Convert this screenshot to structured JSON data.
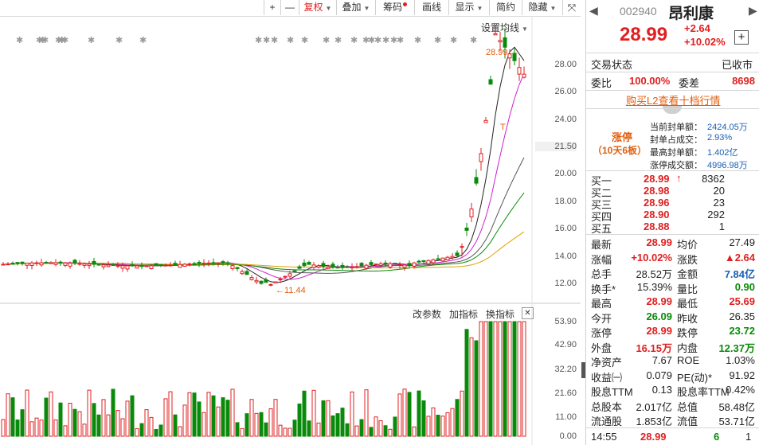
{
  "toolbar": {
    "plus": "+",
    "minus": "—",
    "fuquan": "复权",
    "diejia": "叠加",
    "chouma": "筹码",
    "huaxian": "画线",
    "xianshi": "显示",
    "jianyue": "简约",
    "yincang": "隐藏"
  },
  "chart": {
    "ma_setting": "设置均线",
    "high_label": "28.99",
    "low_label": "11.44",
    "t_marker": "T",
    "indicator_buttons": [
      "改参数",
      "加指标",
      "换指标"
    ],
    "close_label": "✕",
    "price_ticks": [
      "28.00",
      "26.00",
      "24.00",
      "21.50",
      "20.00",
      "18.00",
      "16.00",
      "14.00",
      "12.00"
    ],
    "volume_ticks": [
      "53.90",
      "42.90",
      "32.20",
      "21.60",
      "11.00",
      "0.00"
    ],
    "colors": {
      "up": "#e02020",
      "down": "#0a8a0a"
    }
  },
  "quote": {
    "code": "002940",
    "name": "昂利康",
    "price": "28.99",
    "change": "+2.64",
    "change_pct": "+10.02%",
    "status_label": "交易状态",
    "status_value": "已收市",
    "weibi_label": "委比",
    "weibi_value": "100.00%",
    "weicha_label": "委差",
    "weicha_value": "8698",
    "l2_link": "购买L2查看十档行情",
    "limit_title": "涨停",
    "limit_sub": "（10天6板）",
    "limit_stats": [
      {
        "label": "当前封单额：",
        "value": "2424.05万"
      },
      {
        "label": "封单占成交：",
        "value": "2.93%"
      },
      {
        "label": "最高封单额：",
        "value": "1.402亿"
      },
      {
        "label": "涨停成交额：",
        "value": "4996.98万"
      }
    ],
    "bids": [
      {
        "label": "买一",
        "price": "28.99",
        "vol": "8362"
      },
      {
        "label": "买二",
        "price": "28.98",
        "vol": "20"
      },
      {
        "label": "买三",
        "price": "28.96",
        "vol": "23"
      },
      {
        "label": "买四",
        "price": "28.90",
        "vol": "292"
      },
      {
        "label": "买五",
        "price": "28.88",
        "vol": "1"
      }
    ],
    "stats": [
      {
        "l1": "最新",
        "v1": "28.99",
        "c1": "rd",
        "l2": "均价",
        "v2": "27.49",
        "c2": "lbl"
      },
      {
        "l1": "涨幅",
        "v1": "+10.02%",
        "c1": "rd",
        "l2": "涨跌",
        "v2": "▲2.64",
        "c2": "rd"
      },
      {
        "l1": "总手",
        "v1": "28.52万",
        "c1": "lbl",
        "l2": "金额",
        "v2": "7.84亿",
        "c2": "bl"
      },
      {
        "l1": "换手*",
        "v1": "15.39%",
        "c1": "lbl",
        "l2": "量比",
        "v2": "0.90",
        "c2": "gr"
      },
      {
        "l1": "最高",
        "v1": "28.99",
        "c1": "rd",
        "l2": "最低",
        "v2": "25.69",
        "c2": "rd"
      },
      {
        "l1": "今开",
        "v1": "26.09",
        "c1": "gr",
        "l2": "昨收",
        "v2": "26.35",
        "c2": "lbl"
      },
      {
        "l1": "涨停",
        "v1": "28.99",
        "c1": "rd",
        "l2": "跌停",
        "v2": "23.72",
        "c2": "gr"
      },
      {
        "l1": "外盘",
        "v1": "16.15万",
        "c1": "rd",
        "l2": "内盘",
        "v2": "12.37万",
        "c2": "gr"
      },
      {
        "l1": "净资产",
        "v1": "7.67",
        "c1": "lbl",
        "l2": "ROE",
        "v2": "1.03%",
        "c2": "lbl"
      },
      {
        "l1": "收益㈠",
        "v1": "0.079",
        "c1": "lbl",
        "l2": "PE(动)*",
        "v2": "91.92",
        "c2": "lbl"
      },
      {
        "l1": "股息TTM",
        "v1": "0.13",
        "c1": "lbl",
        "l2": "股息率TTM",
        "v2": "0.42%",
        "c2": "lbl"
      },
      {
        "l1": "总股本",
        "v1": "2.017亿",
        "c1": "lbl",
        "l2": "总值",
        "v2": "58.48亿",
        "c2": "lbl"
      },
      {
        "l1": "流通股",
        "v1": "1.853亿",
        "c1": "lbl",
        "l2": "流值",
        "v2": "53.71亿",
        "c2": "lbl"
      }
    ],
    "tick": {
      "time": "14:55",
      "price": "28.99",
      "vol": "6",
      "num": "1"
    }
  }
}
